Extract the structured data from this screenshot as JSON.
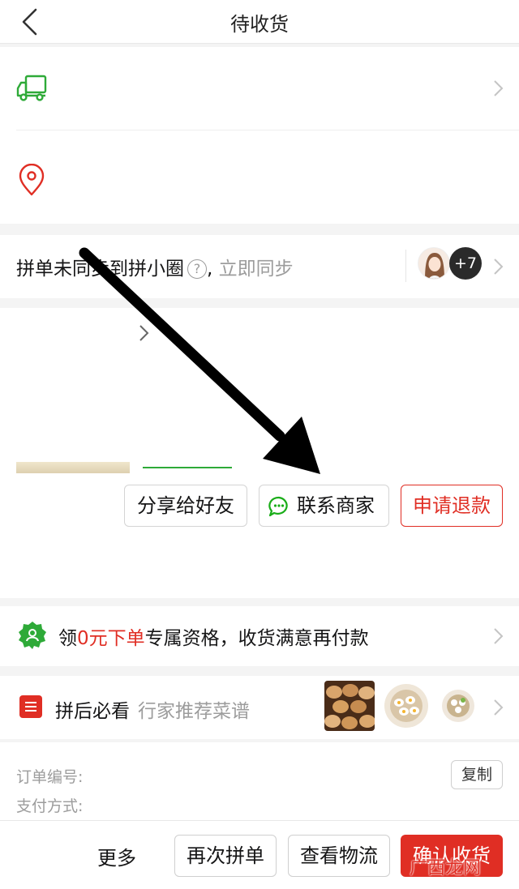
{
  "header": {
    "title": "待收货"
  },
  "sync": {
    "text": "拼单未同步到拼小圈",
    "help": "?",
    "comma": ",",
    "action": "立即同步",
    "more_count": "+7"
  },
  "goods": {
    "share_label": "分享给好友",
    "contact_label": "联系商家",
    "refund_label": "申请退款"
  },
  "promo": {
    "prefix": "领",
    "highlight": "0元下单",
    "suffix": "专属资格，收货满意再付款"
  },
  "recipe": {
    "title": "拼后必看",
    "subtitle": "行家推荐菜谱"
  },
  "order_info": {
    "order_no_label": "订单编号:",
    "payment_label": "支付方式:",
    "copy_label": "复制"
  },
  "bottom": {
    "more_label": "更多",
    "reorder_label": "再次拼单",
    "logistics_label": "查看物流",
    "confirm_label": "确认收货"
  },
  "watermark": "广西龙网",
  "colors": {
    "accent_red": "#e02e24",
    "icon_green": "#2eaa38",
    "wechat_green": "#1aad19",
    "muted": "#9c9c9c"
  },
  "icons": [
    "back-arrow-icon",
    "truck-icon",
    "location-pin-icon",
    "help-icon",
    "chevron-right-icon",
    "chat-bubble-icon",
    "badge-user-icon",
    "recipe-list-icon"
  ]
}
